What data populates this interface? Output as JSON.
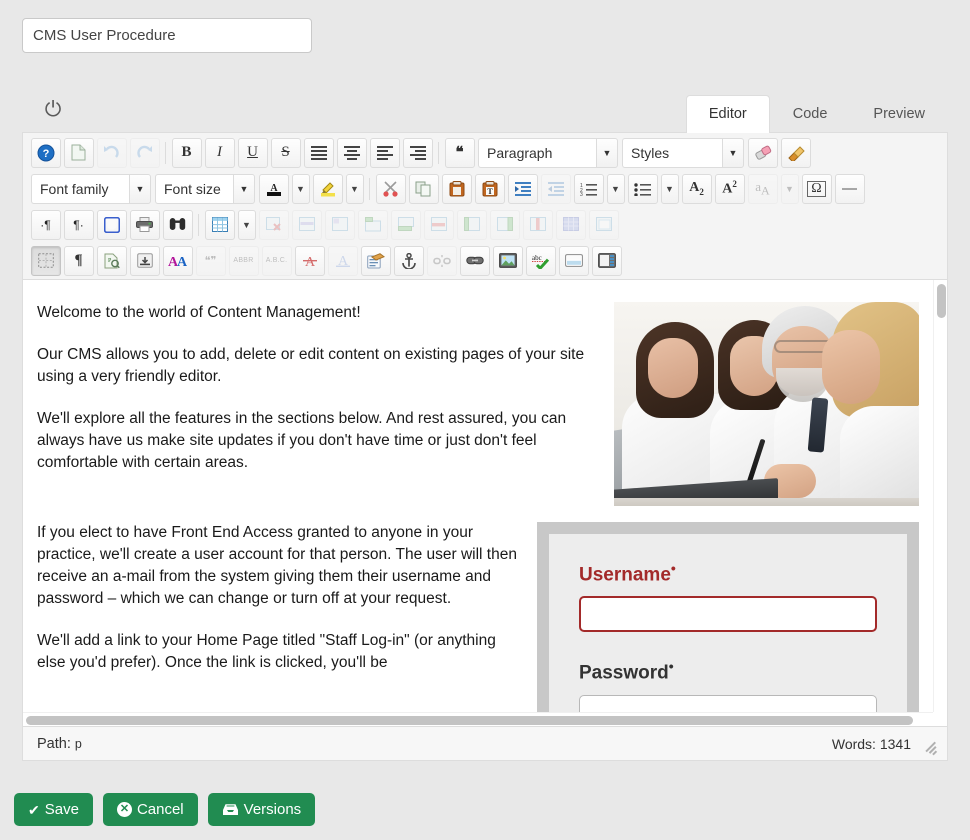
{
  "title_field": {
    "value": "CMS User Procedure",
    "placeholder": "Page title"
  },
  "power_icon": "⏻",
  "tabs": [
    {
      "label": "Editor",
      "active": true
    },
    {
      "label": "Code",
      "active": false
    },
    {
      "label": "Preview",
      "active": false
    }
  ],
  "toolbar": {
    "row1": [
      {
        "name": "help",
        "glyph": "?",
        "type": "help"
      },
      {
        "name": "new-document",
        "glyph": "",
        "type": "doc"
      },
      {
        "name": "undo",
        "glyph": "↺",
        "type": "undo",
        "disabled": true
      },
      {
        "name": "redo",
        "glyph": "↻",
        "type": "redo",
        "disabled": true
      },
      {
        "name": "bold",
        "glyph": "B",
        "type": "bold"
      },
      {
        "name": "italic",
        "glyph": "I",
        "type": "italic"
      },
      {
        "name": "underline",
        "glyph": "U",
        "type": "underline"
      },
      {
        "name": "strikethrough",
        "glyph": "S",
        "type": "strike"
      },
      {
        "name": "align-justify",
        "glyph": "",
        "type": "align-justify"
      },
      {
        "name": "align-center",
        "glyph": "",
        "type": "align-center"
      },
      {
        "name": "align-left",
        "glyph": "",
        "type": "align-left"
      },
      {
        "name": "align-right",
        "glyph": "",
        "type": "align-right"
      },
      {
        "name": "blockquote",
        "glyph": "❝",
        "type": "quote"
      }
    ],
    "format_select": {
      "label": "Paragraph",
      "caret": "▼"
    },
    "styles_select": {
      "label": "Styles",
      "caret": "▼"
    },
    "row1_tail": [
      {
        "name": "remove-format",
        "type": "eraser"
      },
      {
        "name": "format-painter",
        "type": "brush"
      }
    ],
    "font_family_select": {
      "label": "Font family",
      "caret": "▼"
    },
    "font_size_select": {
      "label": "Font size",
      "caret": "▼"
    },
    "row2": [
      {
        "name": "text-color",
        "type": "forecolor",
        "caret": "▼"
      },
      {
        "name": "background-color",
        "type": "backcolor",
        "caret": "▼"
      },
      {
        "name": "cut",
        "type": "scissors"
      },
      {
        "name": "copy",
        "type": "copy"
      },
      {
        "name": "paste",
        "type": "paste"
      },
      {
        "name": "paste-as-text",
        "type": "paste-text"
      },
      {
        "name": "indent",
        "type": "indent"
      },
      {
        "name": "outdent",
        "type": "outdent",
        "disabled": true
      },
      {
        "name": "numbered-list",
        "type": "ol",
        "caret": "▼"
      },
      {
        "name": "bulleted-list",
        "type": "ul",
        "caret": "▼"
      },
      {
        "name": "subscript",
        "type": "sub",
        "glyph": "A₂"
      },
      {
        "name": "superscript",
        "type": "sup",
        "glyph": "A²"
      },
      {
        "name": "find-replace-text",
        "type": "aa-small",
        "disabled": true,
        "caret": "▼"
      },
      {
        "name": "special-character",
        "type": "omega",
        "glyph": "Ω"
      },
      {
        "name": "horizontal-rule",
        "type": "hr",
        "glyph": "—"
      }
    ],
    "row3": [
      {
        "name": "ltr-direction",
        "type": "ltr",
        "glyph": "¶"
      },
      {
        "name": "rtl-direction",
        "type": "rtl",
        "glyph": "¶"
      },
      {
        "name": "fullscreen",
        "type": "fullscreen"
      },
      {
        "name": "print",
        "type": "print"
      },
      {
        "name": "search",
        "type": "binoculars"
      },
      {
        "name": "insert-table",
        "type": "table",
        "caret": "▼"
      },
      {
        "name": "delete-table",
        "type": "table-del",
        "disabled": true
      },
      {
        "name": "table-row-properties",
        "type": "table-rowprop",
        "disabled": true
      },
      {
        "name": "table-cell-properties",
        "type": "table-cellprop",
        "disabled": true
      },
      {
        "name": "insert-row-before",
        "type": "row-before",
        "disabled": true
      },
      {
        "name": "insert-row-after",
        "type": "row-after",
        "disabled": true
      },
      {
        "name": "delete-row",
        "type": "row-del",
        "disabled": true
      },
      {
        "name": "insert-column-before",
        "type": "col-before",
        "disabled": true
      },
      {
        "name": "insert-column-after",
        "type": "col-after",
        "disabled": true
      },
      {
        "name": "delete-column",
        "type": "col-del",
        "disabled": true
      },
      {
        "name": "split-merged-cells",
        "type": "table-grid",
        "disabled": true
      },
      {
        "name": "merge-cells",
        "type": "table-merge",
        "disabled": true
      }
    ],
    "row4": [
      {
        "name": "visual-blocks",
        "type": "visualblocks",
        "pressed": true
      },
      {
        "name": "visual-characters",
        "type": "pilcrow",
        "glyph": "¶"
      },
      {
        "name": "page-properties",
        "type": "pageprops"
      },
      {
        "name": "page-break",
        "type": "pagebreak"
      },
      {
        "name": "text-case",
        "type": "aa-big",
        "glyph": "AA"
      },
      {
        "name": "blockquote-cite",
        "type": "quotes",
        "disabled": true
      },
      {
        "name": "abbreviation",
        "type": "abbr",
        "glyph": "ABBR",
        "disabled": true
      },
      {
        "name": "acronym",
        "type": "acronym",
        "glyph": "A.B.C.",
        "disabled": true
      },
      {
        "name": "deleted-text",
        "type": "del-a",
        "glyph": "A"
      },
      {
        "name": "inserted-text",
        "type": "ins-a",
        "glyph": "A",
        "disabled": true
      },
      {
        "name": "insert-template",
        "type": "template"
      },
      {
        "name": "insert-anchor",
        "type": "anchor"
      },
      {
        "name": "unlink",
        "type": "unlink",
        "disabled": true
      },
      {
        "name": "insert-link",
        "type": "link"
      },
      {
        "name": "insert-image",
        "type": "image"
      },
      {
        "name": "spellcheck",
        "type": "spellcheck",
        "glyph": "abc"
      },
      {
        "name": "insert-horizontal-layout",
        "type": "layout-h"
      },
      {
        "name": "insert-sidebar-layout",
        "type": "layout-s"
      }
    ]
  },
  "content": {
    "block1": {
      "paragraphs": [
        "Welcome to the world of Content Management!",
        "Our CMS allows you to add, delete or edit content on existing pages of your site using a very friendly editor.",
        "We'll explore all the features in the sections below. And rest assured, you can always have us make site updates if you don't have time or just don't feel comfortable with certain areas."
      ],
      "image_alt": "Four medical professionals reviewing content on a laptop"
    },
    "block2": {
      "paragraphs": [
        "If you elect to have Front End Access granted to anyone in your practice, we'll create a user account for that person. The user will then receive an a-mail from the system giving them their username and password – which we can change or turn off at your request.",
        "We'll add a link to your Home Page titled \"Staff Log-in\" (or anything else you'd prefer). Once the link is clicked, you'll be"
      ],
      "login_form": {
        "username_label": "Username",
        "username_required_mark": "•",
        "username_value": "",
        "password_label": "Password",
        "password_required_mark": "•",
        "password_value": ""
      }
    }
  },
  "statusbar": {
    "path_label": "Path:",
    "path_value": "p",
    "word_count_label": "Words:",
    "word_count_value": "1341",
    "resize_grip": "resize-grip"
  },
  "actions": [
    {
      "name": "save",
      "label": "Save",
      "icon": "check"
    },
    {
      "name": "cancel",
      "label": "Cancel",
      "icon": "circle-x"
    },
    {
      "name": "versions",
      "label": "Versions",
      "icon": "inbox"
    }
  ],
  "colors": {
    "accent_green": "#218c51",
    "required_red": "#a32a2a",
    "page_bg": "#e8e8e8",
    "toolbar_bg": "#f4f4f4"
  }
}
